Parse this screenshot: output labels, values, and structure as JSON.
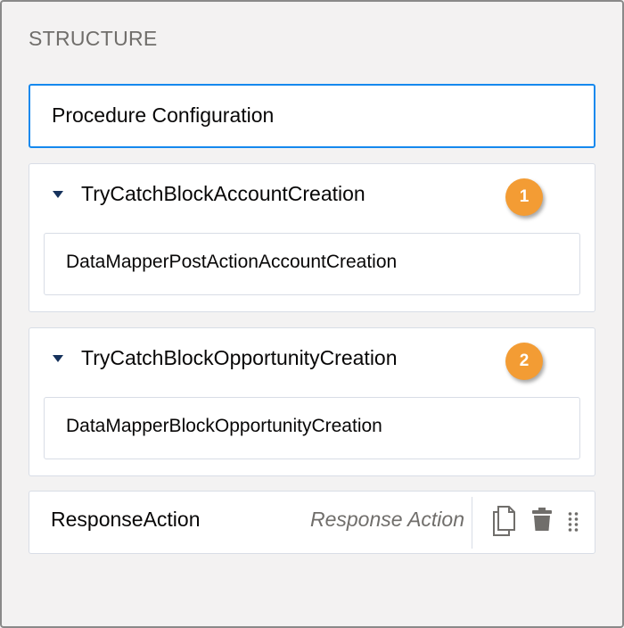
{
  "panel": {
    "title": "STRUCTURE"
  },
  "config_card": {
    "label": "Procedure Configuration"
  },
  "blocks": [
    {
      "label": "TryCatchBlockAccountCreation",
      "badge": "1",
      "child": {
        "label": "DataMapperPostActionAccountCreation"
      }
    },
    {
      "label": "TryCatchBlockOpportunityCreation",
      "badge": "2",
      "child": {
        "label": "DataMapperBlockOpportunityCreation"
      }
    }
  ],
  "response_action": {
    "label": "ResponseAction",
    "type_label": "Response Action",
    "icons": [
      "copy-icon",
      "trash-icon",
      "drag-handle-icon"
    ]
  },
  "colors": {
    "accent": "#1589ee",
    "badge": "#f39c34",
    "border": "#d8dde6",
    "muted_text": "#706e6b"
  }
}
